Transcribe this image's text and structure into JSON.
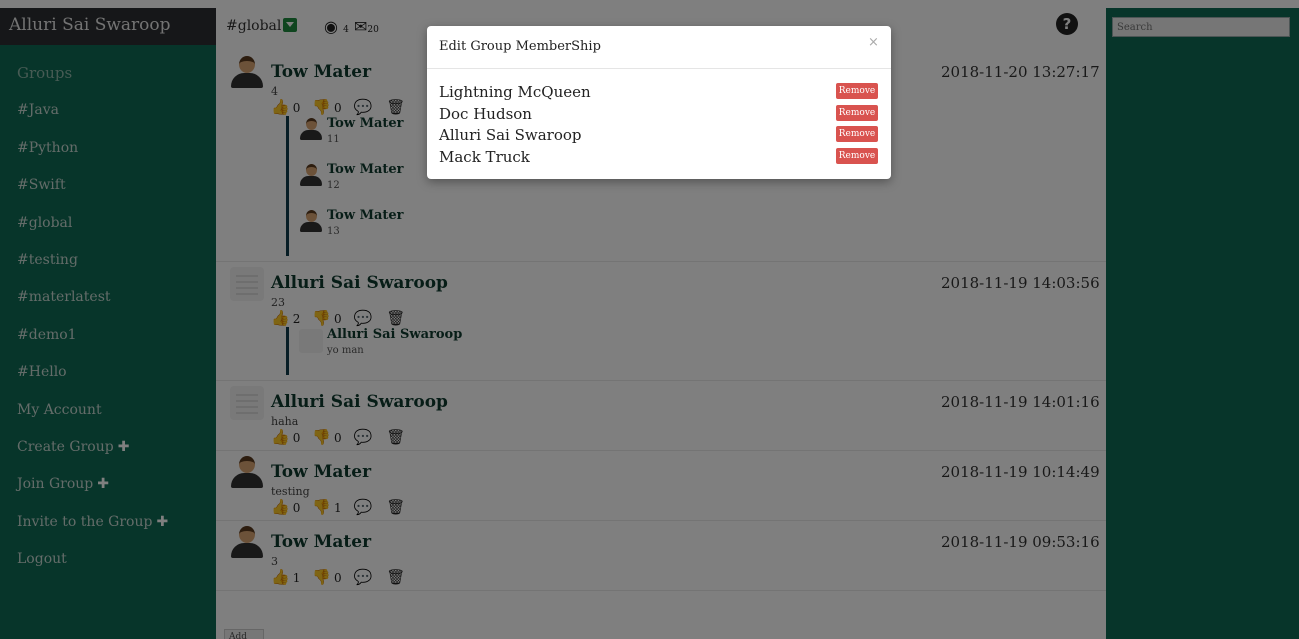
{
  "app": {
    "user_name": "Alluri Sai Swaroop"
  },
  "sidebar": {
    "groups_heading": "Groups",
    "groups": [
      "#Java",
      "#Python",
      "#Swift",
      "#global",
      "#testing",
      "#materlatest",
      "#demo1",
      "#Hello"
    ],
    "links": [
      {
        "label": "My Account",
        "plus": false
      },
      {
        "label": "Create Group",
        "plus": true
      },
      {
        "label": "Join Group",
        "plus": true
      },
      {
        "label": "Invite to the Group",
        "plus": true
      },
      {
        "label": "Logout",
        "plus": false
      }
    ],
    "plus_glyph": "✚"
  },
  "topbar": {
    "channel": "#global",
    "member_count": "4",
    "message_count": "20",
    "help_icon": "?"
  },
  "search": {
    "placeholder": "Search"
  },
  "posts": [
    {
      "author": "Tow Mater",
      "avatar": "person",
      "text": "4",
      "time": "2018-11-20 13:27:17",
      "likes": "0",
      "dislikes": "0",
      "replies": [
        {
          "name": "Tow Mater",
          "text": "11"
        },
        {
          "name": "Tow Mater",
          "text": "12"
        },
        {
          "name": "Tow Mater",
          "text": "13"
        }
      ]
    },
    {
      "author": "Alluri Sai Swaroop",
      "avatar": "doc",
      "text": "23",
      "time": "2018-11-19 14:03:56",
      "likes": "2",
      "dislikes": "0",
      "replies": [
        {
          "name": "Alluri Sai Swaroop",
          "text": "yo man"
        }
      ]
    },
    {
      "author": "Alluri Sai Swaroop",
      "avatar": "doc",
      "text": "haha",
      "time": "2018-11-19 14:01:16",
      "likes": "0",
      "dislikes": "0",
      "replies": []
    },
    {
      "author": "Tow Mater",
      "avatar": "person",
      "text": "testing",
      "time": "2018-11-19 10:14:49",
      "likes": "0",
      "dislikes": "1",
      "replies": []
    },
    {
      "author": "Tow Mater",
      "avatar": "person",
      "text": "3",
      "time": "2018-11-19 09:53:16",
      "likes": "1",
      "dislikes": "0",
      "replies": []
    }
  ],
  "add_button": "Add",
  "modal": {
    "title": "Edit Group MemberShip",
    "close": "×",
    "remove_label": "Remove",
    "members": [
      "Lightning McQueen",
      "Doc Hudson",
      "Alluri Sai Swaroop",
      "Mack Truck"
    ]
  },
  "colors": {
    "sidebar": "#0e6b55",
    "brand_bar": "#2c2f33",
    "remove": "#d9534f",
    "thread_line": "#0f3b4a"
  },
  "icons": {
    "like": "thumbs-up-icon",
    "dislike": "thumbs-down-icon",
    "comment": "comment-icon",
    "delete": "trash-icon",
    "members": "user-circle-icon",
    "messages": "envelope-icon",
    "help": "question-circle-icon"
  }
}
